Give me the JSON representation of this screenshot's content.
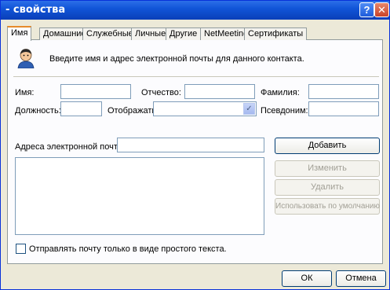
{
  "window": {
    "title": "- свойства",
    "help_glyph": "?",
    "close_glyph": "✕"
  },
  "tabs": [
    {
      "label": "Имя",
      "active": true
    },
    {
      "label": "Домашние",
      "active": false
    },
    {
      "label": "Служебные",
      "active": false
    },
    {
      "label": "Личные",
      "active": false
    },
    {
      "label": "Другие",
      "active": false
    },
    {
      "label": "NetMeeting",
      "active": false
    },
    {
      "label": "Сертификаты",
      "active": false
    }
  ],
  "intro_text": "Введите имя и адрес электронной почты для данного контакта.",
  "name_fields": {
    "first_name_label": "Имя:",
    "middle_name_label": "Отчество:",
    "last_name_label": "Фамилия:",
    "title_label": "Должность:",
    "display_label": "Отображать:",
    "nickname_label": "Псевдоним:",
    "first_name_value": "",
    "middle_name_value": "",
    "last_name_value": "",
    "title_value": "",
    "display_value": "",
    "nickname_value": "",
    "display_arrow": "✓"
  },
  "email": {
    "label": "Адреса электронной почты:",
    "value": "",
    "add_button": "Добавить",
    "edit_button": "Изменить",
    "delete_button": "Удалить",
    "default_button": "Использовать по умолчанию"
  },
  "plain_text_checkbox": {
    "label": "Отправлять почту только в виде простого текста.",
    "checked": false
  },
  "footer": {
    "ok_button": "ОК",
    "cancel_button": "Отмена"
  }
}
